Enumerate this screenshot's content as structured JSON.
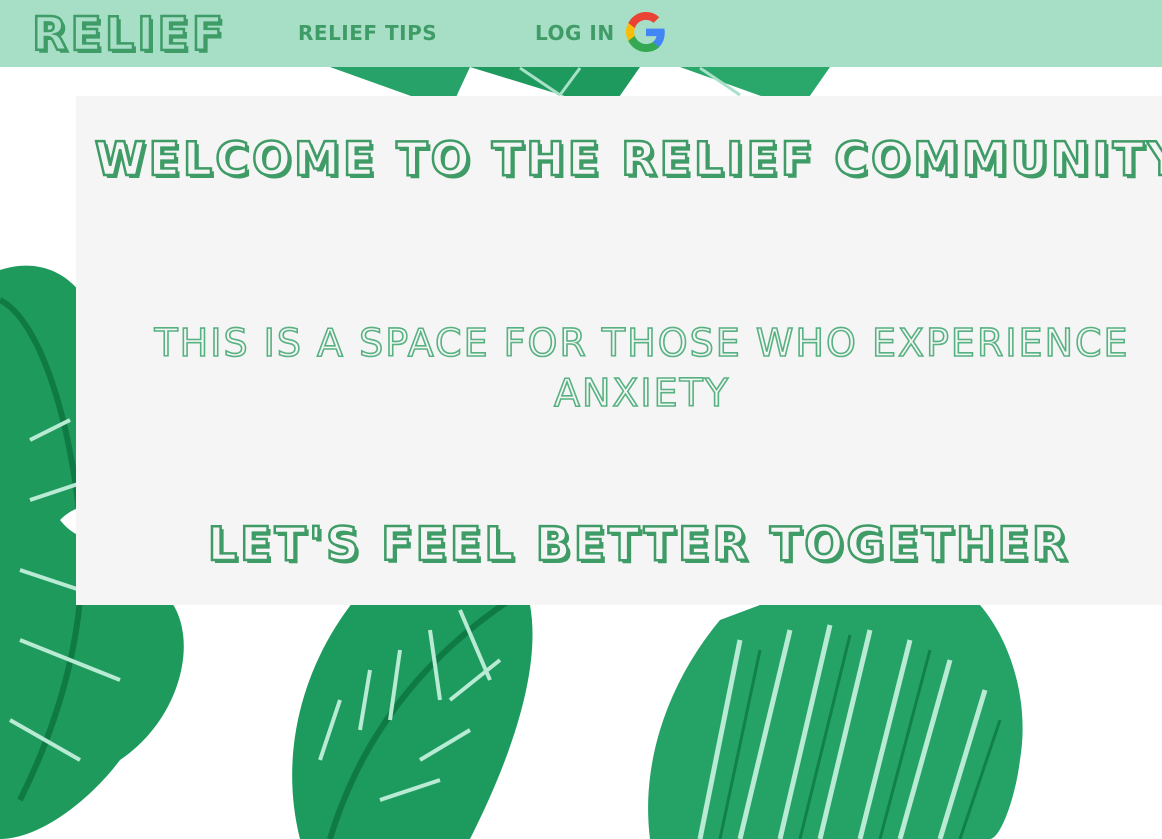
{
  "nav": {
    "brand": "RELIEF",
    "tips_label": "RELIEF TIPS",
    "login_label": "LOG IN",
    "login_icon": "google-icon"
  },
  "main": {
    "title": "WELCOME TO THE RELIEF COMMUNITY",
    "subtitle": "THIS IS A SPACE FOR THOSE WHO EXPERIENCE ANXIETY",
    "tagline": "LET'S FEEL BETTER TOGETHER"
  },
  "colors": {
    "nav_bg": "#a6dec6",
    "brand_green": "#3f9c66",
    "panel_bg": "#f5f5f5",
    "leaf_green": "#1f9a5e"
  }
}
